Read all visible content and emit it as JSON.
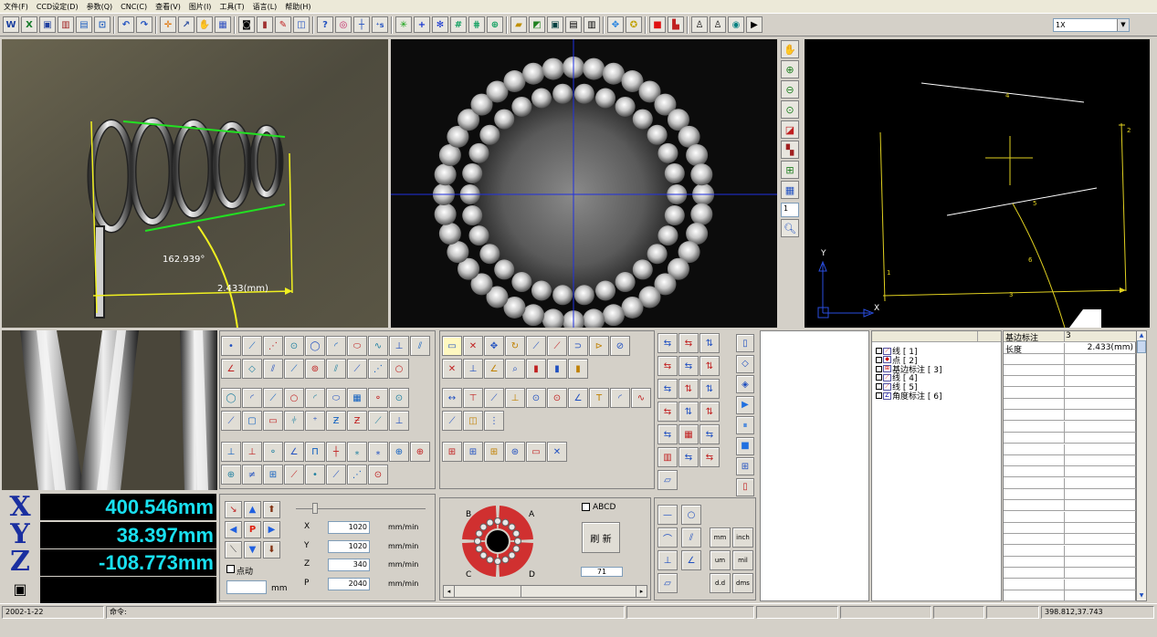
{
  "menu": [
    "文件(F)",
    "CCD设定(D)",
    "参数(Q)",
    "CNC(C)",
    "查看(V)",
    "图片(I)",
    "工具(T)",
    "语言(L)",
    "帮助(H)"
  ],
  "toolbar": {
    "zoom_value": "1X"
  },
  "view_left": {
    "angle_label": "162.939°",
    "dist_label": "2.433(mm)"
  },
  "view_right": {
    "axis_y": "Y",
    "axis_x": "X",
    "labels": [
      "4",
      "2",
      "5",
      "6",
      "1",
      "3"
    ]
  },
  "side_tools": {
    "spin_value": "1"
  },
  "readout": {
    "x_axis": "X",
    "y_axis": "Y",
    "z_axis": "Z",
    "x_value": "400.546mm",
    "y_value": "38.397mm",
    "z_value": "-108.773mm"
  },
  "jog": {
    "p_label": "P",
    "inching_label": "点动",
    "mm_label": "mm",
    "rows": [
      {
        "axis": "X",
        "value": "1020",
        "unit": "mm/min"
      },
      {
        "axis": "Y",
        "value": "1020",
        "unit": "mm/min"
      },
      {
        "axis": "Z",
        "value": "340",
        "unit": "mm/min"
      },
      {
        "axis": "P",
        "value": "2040",
        "unit": "mm/min"
      }
    ]
  },
  "light": {
    "label_a": "A",
    "label_b": "B",
    "label_c": "C",
    "label_d": "D",
    "abcd_label": "ABCD",
    "refresh_label": "刷 新",
    "level_value": "71"
  },
  "units": {
    "mm": "mm",
    "inch": "inch",
    "um": "um",
    "mil": "mil",
    "dd": "d.d",
    "dms": "dms"
  },
  "tree": [
    {
      "label": "线 [ 1]",
      "type": "line"
    },
    {
      "label": "点 [ 2]",
      "type": "point"
    },
    {
      "label": "基边标注 [ 3]",
      "type": "dim"
    },
    {
      "label": "线 [ 4]",
      "type": "line"
    },
    {
      "label": "线 [ 5]",
      "type": "line"
    },
    {
      "label": "角度标注 [ 6]",
      "type": "angle"
    }
  ],
  "props": {
    "header_name": "基边标注",
    "header_value": "3",
    "row_name": "长度",
    "row_value": "2.433(mm)"
  },
  "status": {
    "date": "2002-1-22",
    "command_label": "命令:",
    "coords": "398.812,37.743"
  },
  "colors": {
    "readout_text": "#19e0f0",
    "accent": "#1a2fa0"
  }
}
